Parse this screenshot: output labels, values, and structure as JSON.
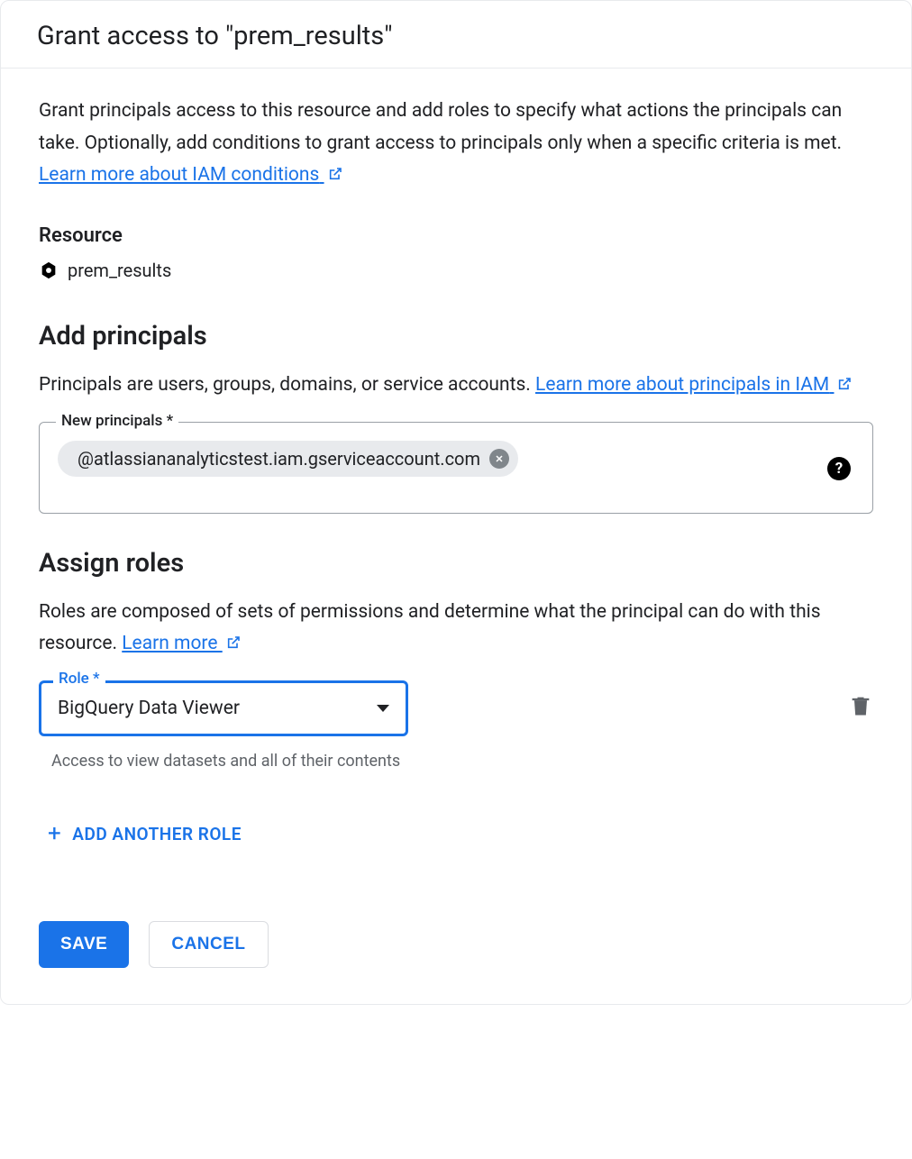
{
  "header": {
    "title": "Grant access to \"prem_results\""
  },
  "intro": {
    "text_before_link": "Grant principals access to this resource and add roles to specify what actions the principals can take. Optionally, add conditions to grant access to principals only when a specific criteria is met. ",
    "link_text": "Learn more about IAM conditions"
  },
  "resource": {
    "heading": "Resource",
    "name": "prem_results"
  },
  "principals": {
    "heading": "Add principals",
    "desc_before_link": "Principals are users, groups, domains, or service accounts. ",
    "link_text": "Learn more about principals in IAM",
    "field_label": "New principals *",
    "chip_value": "@atlassiananalyticstest.iam.gserviceaccount.com"
  },
  "roles": {
    "heading": "Assign roles",
    "desc_before_link": "Roles are composed of sets of permissions and determine what the principal can do with this resource. ",
    "link_text": "Learn more",
    "field_label": "Role *",
    "selected_role": "BigQuery Data Viewer",
    "role_helper": "Access to view datasets and all of their contents",
    "add_another_label": "ADD ANOTHER ROLE"
  },
  "footer": {
    "save_label": "SAVE",
    "cancel_label": "CANCEL"
  }
}
